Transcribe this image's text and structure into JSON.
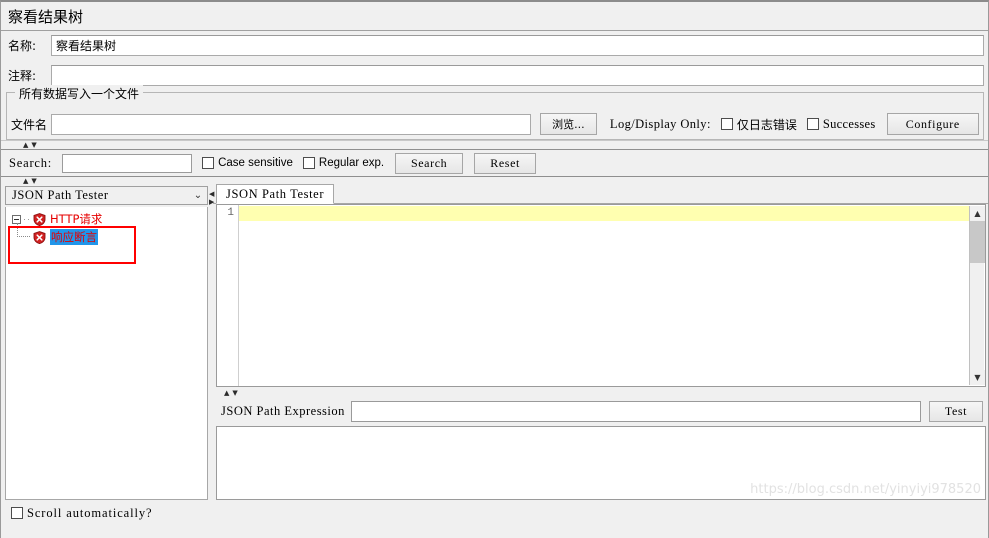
{
  "window": {
    "title": "察看结果树"
  },
  "fields": {
    "name_label": "名称:",
    "name_value": "察看结果树",
    "comment_label": "注释:",
    "comment_value": ""
  },
  "file_group": {
    "legend": "所有数据写入一个文件",
    "filename_label": "文件名",
    "filename_value": "",
    "browse_label": "浏览...",
    "log_display_only_label": "Log/Display Only:",
    "errors_only_label": "仅日志错误",
    "errors_only_checked": false,
    "successes_label": "Successes",
    "successes_checked": false,
    "configure_label": "Configure"
  },
  "search": {
    "label": "Search:",
    "value": "",
    "case_sensitive_label": "Case sensitive",
    "case_sensitive_checked": false,
    "regular_exp_label": "Regular exp.",
    "regular_exp_checked": false,
    "search_button": "Search",
    "reset_button": "Reset"
  },
  "left_panel": {
    "renderer_selected": "JSON Path Tester",
    "chevron": "⌄",
    "tree": [
      {
        "label": "HTTP请求",
        "level": 0,
        "selected": false,
        "status": "error"
      },
      {
        "label": "响应断言",
        "level": 1,
        "selected": true,
        "status": "error"
      }
    ],
    "scroll_automatically_label": "Scroll automatically?",
    "scroll_automatically_checked": false
  },
  "right_panel": {
    "tab_label": "JSON Path Tester",
    "editor": {
      "line_numbers": [
        "1"
      ],
      "lines": [
        ""
      ]
    },
    "expression_label": "JSON Path Expression",
    "expression_value": "",
    "test_button": "Test",
    "results_value": ""
  },
  "watermark": "https://blog.csdn.net/yinyiyi978520",
  "colors": {
    "error_text": "#e60000",
    "selection": "#2196ea",
    "current_line": "#ffffb0",
    "annotation": "#ff0000",
    "panel_bg": "#f0f0f0"
  }
}
